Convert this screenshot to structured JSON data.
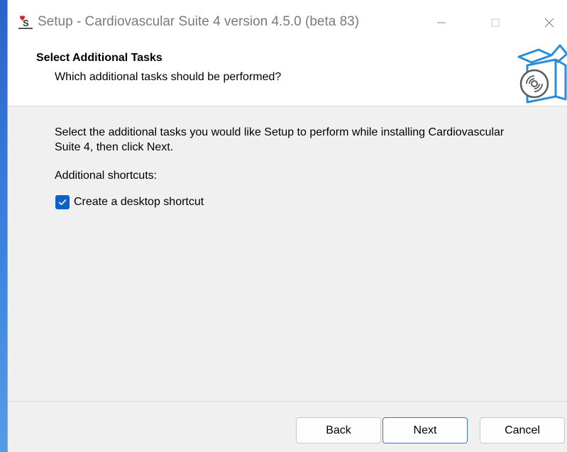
{
  "window": {
    "title": "Setup - Cardiovascular Suite 4 version 4.5.0 (beta 83)",
    "controls": {
      "minimize": "—",
      "maximize": "☐",
      "close": "✕"
    }
  },
  "header": {
    "title": "Select Additional Tasks",
    "subtitle": "Which additional tasks should be performed?",
    "icon": "installer-box-icon"
  },
  "body": {
    "description": "Select the additional tasks you would like Setup to perform while installing Cardiovascular Suite 4, then click Next.",
    "group_label": "Additional shortcuts:",
    "options": [
      {
        "label": "Create a desktop shortcut",
        "checked": true
      }
    ]
  },
  "buttons": {
    "back": "Back",
    "next": "Next",
    "cancel": "Cancel"
  },
  "colors": {
    "accent": "#0a63c4",
    "focus_border": "#2e7bd6",
    "window_bg": "#f0f0f0"
  }
}
